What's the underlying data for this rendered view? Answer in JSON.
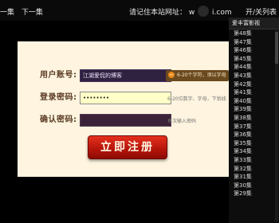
{
  "topbar": {
    "prev_label": "一集",
    "next_label": "下一集",
    "notice_prefix": "请记住本站网址：",
    "notice_domain_visible": "w",
    "notice_domain_visible2": "i.com",
    "toggle_label": "开/关列表"
  },
  "sidebar": {
    "title": "爱丰富影视",
    "episodes": [
      "第48集",
      "第47集",
      "第46集",
      "第45集",
      "第44集",
      "第43集",
      "第42集",
      "第41集",
      "第40集",
      "第39集",
      "第38集",
      "第37集",
      "第36集",
      "第35集",
      "第34集",
      "第33集",
      "第32集",
      "第31集",
      "第30集",
      "第29集"
    ]
  },
  "form": {
    "username_label": "用户账号:",
    "username_value": "江湖爱侃的博客",
    "username_hint": "6-20个字符，须以字母",
    "password_label": "登录密码:",
    "password_value": "••••••••",
    "password_hint": "6-20位数字、字母，下划线",
    "confirm_label": "确认密码:",
    "confirm_value": "",
    "confirm_hint": "再次输入密码",
    "submit_label": "立即注册"
  },
  "colors": {
    "page_bg": "#000000",
    "panel_bg": "#fef4df",
    "label_color": "#5a3a24",
    "submit_bg": "#c0180c"
  }
}
